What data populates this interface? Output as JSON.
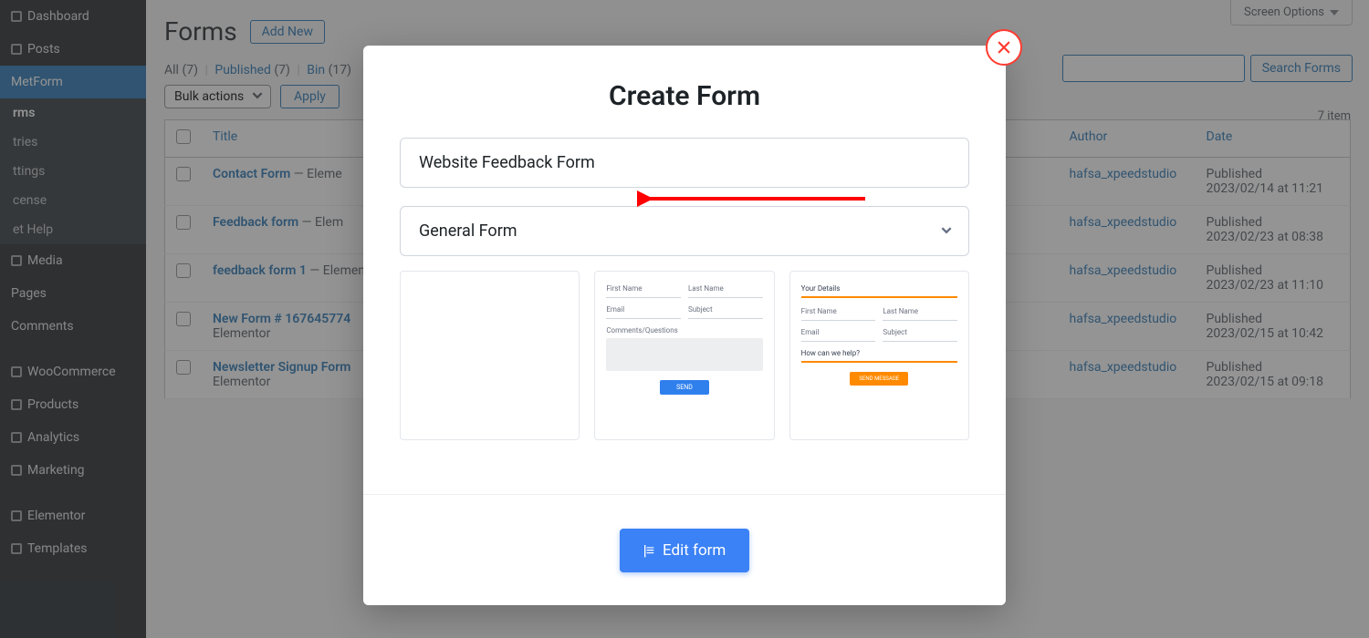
{
  "sidebar": {
    "items": [
      {
        "label": "Dashboard"
      },
      {
        "label": "Posts"
      },
      {
        "label": "MetForm",
        "active": true
      },
      {
        "label": "Media"
      },
      {
        "label": "Pages"
      },
      {
        "label": "Comments"
      },
      {
        "label": "WooCommerce"
      },
      {
        "label": "Products"
      },
      {
        "label": "Analytics"
      },
      {
        "label": "Marketing"
      },
      {
        "label": "Elementor"
      },
      {
        "label": "Templates"
      }
    ],
    "submenu": [
      {
        "label": "rms",
        "current": true
      },
      {
        "label": "tries"
      },
      {
        "label": "ttings"
      },
      {
        "label": "cense"
      },
      {
        "label": "et Help"
      }
    ]
  },
  "header": {
    "screen_options": "Screen Options",
    "page_title": "Forms",
    "add_new": "Add New"
  },
  "filters": {
    "all_label": "All",
    "all_count": "(7)",
    "published_label": "Published",
    "published_count": "(7)",
    "bin_label": "Bin",
    "bin_count": "(17)"
  },
  "bulk": {
    "label": "Bulk actions",
    "apply": "Apply"
  },
  "search": {
    "button": "Search Forms"
  },
  "item_count": "7 item",
  "table": {
    "columns": {
      "title": "Title",
      "author": "Author",
      "date": "Date"
    },
    "rows": [
      {
        "title": "Contact Form",
        "suffix": " — Eleme",
        "author": "hafsa_xpeedstudio",
        "status": "Published",
        "date": "2023/02/14 at 11:21"
      },
      {
        "title": "Feedback form",
        "suffix": " — Elem",
        "author": "hafsa_xpeedstudio",
        "status": "Published",
        "date": "2023/02/23 at 08:38"
      },
      {
        "title": "feedback form 1",
        "suffix": " — Elementor",
        "author": "hafsa_xpeedstudio",
        "status": "Published",
        "date": "2023/02/23 at 11:10"
      },
      {
        "title": "New Form # 167645774",
        "suffix": "Elementor",
        "author": "hafsa_xpeedstudio",
        "status": "Published",
        "date": "2023/02/15 at 10:42"
      },
      {
        "title": "Newsletter Signup Form",
        "suffix": "Elementor",
        "author": "hafsa_xpeedstudio",
        "status": "Published",
        "date": "2023/02/15 at 09:18"
      }
    ]
  },
  "modal": {
    "title": "Create Form",
    "name_value": "Website Feedback Form",
    "type_value": "General Form",
    "edit_button": "Edit form",
    "templates": {
      "t2": {
        "fn": "First Name",
        "ln": "Last Name",
        "email": "Email",
        "subject": "Subject",
        "comments": "Comments/Questions",
        "send": "SEND"
      },
      "t3": {
        "details": "Your Details",
        "fn": "First Name",
        "ln": "Last Name",
        "email": "Email",
        "subject": "Subject",
        "help": "How can we help?",
        "send": "SEND MESSAGE"
      }
    }
  }
}
